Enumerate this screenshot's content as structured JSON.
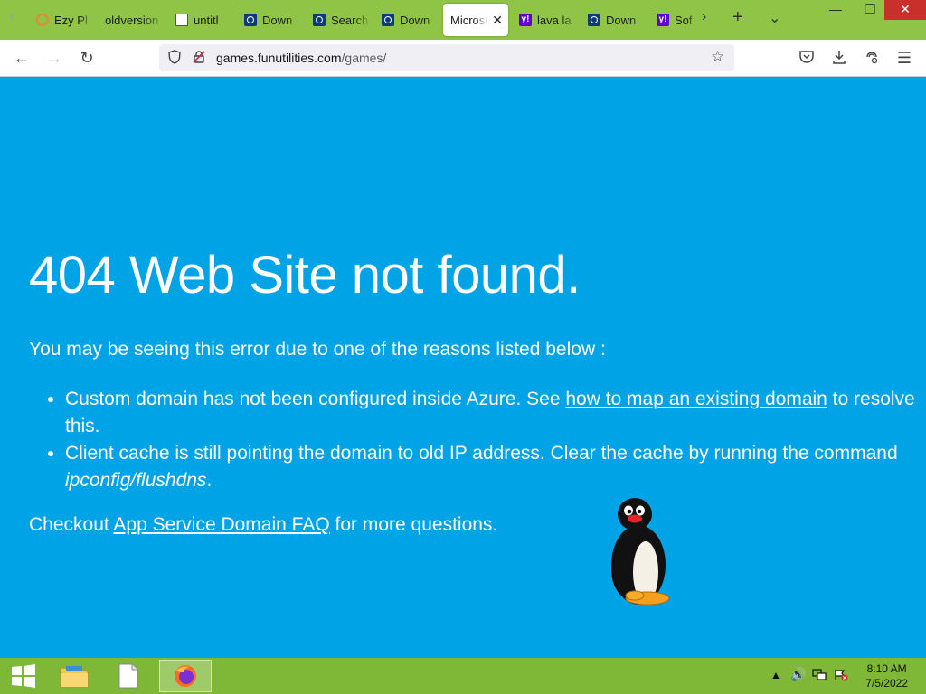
{
  "browser": {
    "tabs": [
      {
        "label": "Ezy Pl",
        "icon": "loading-ring-icon"
      },
      {
        "label": "oldversion",
        "icon": "none"
      },
      {
        "label": "untitl",
        "icon": "document-icon"
      },
      {
        "label": "Down",
        "icon": "site-circle-icon"
      },
      {
        "label": "Search",
        "icon": "site-circle-icon"
      },
      {
        "label": "Down",
        "icon": "site-circle-icon"
      },
      {
        "label": "Microso",
        "icon": "none",
        "active": true
      },
      {
        "label": "lava la",
        "icon": "yahoo-icon"
      },
      {
        "label": "Down",
        "icon": "site-circle-icon"
      },
      {
        "label": "Sof",
        "icon": "yahoo-icon"
      }
    ],
    "url_host": "games.funutilities.com",
    "url_path": "/games/"
  },
  "page": {
    "heading": "404 Web Site not found.",
    "intro": "You may be seeing this error due to one of the reasons listed below :",
    "reason1_before": "Custom domain has not been configured inside Azure. See ",
    "reason1_link": "how to map an existing domain",
    "reason1_after": " to resolve this.",
    "reason2_before": "Client cache is still pointing the domain to old IP address. Clear the cache by running the command ",
    "reason2_cmd": "ipconfig/flushdns",
    "reason2_after": ".",
    "faq_before": "Checkout ",
    "faq_link": "App Service Domain FAQ",
    "faq_after": " for more questions."
  },
  "taskbar": {
    "time": "8:10 AM",
    "date": "7/5/2022"
  },
  "colors": {
    "page_bg": "#00a3e6",
    "tabstrip_bg": "#8fc446",
    "taskbar_bg": "#7fb837"
  }
}
